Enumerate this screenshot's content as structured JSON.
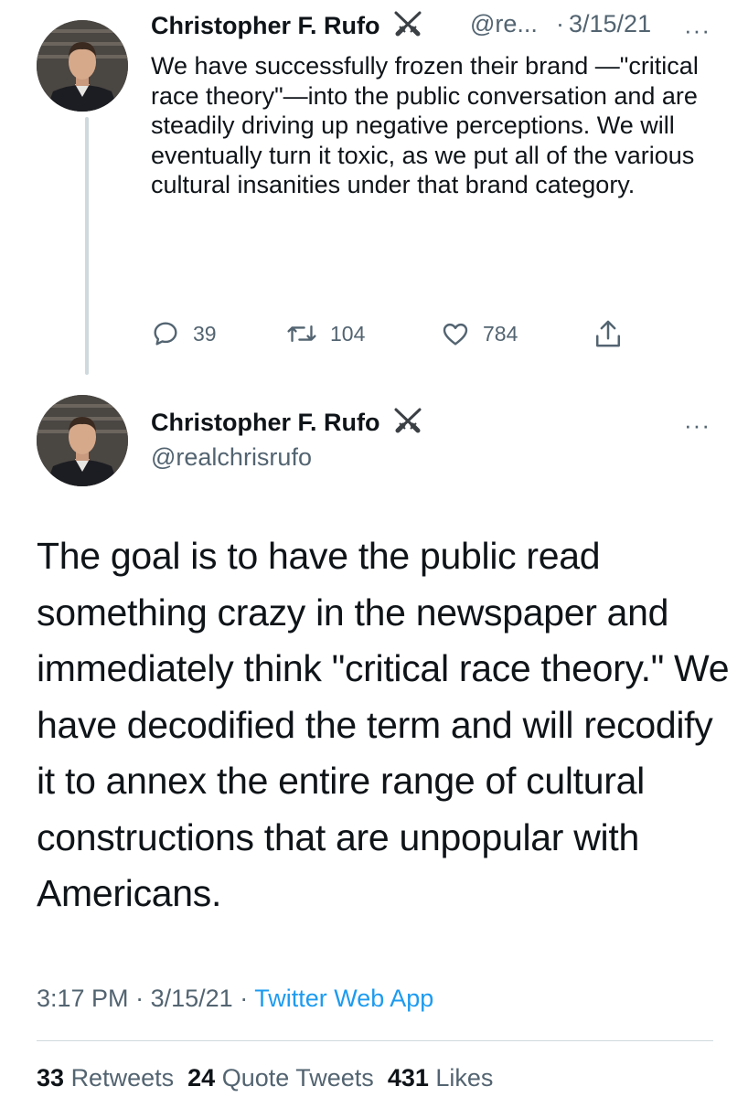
{
  "first_tweet": {
    "author_name": "Christopher F. Rufo",
    "author_handle_truncated": "@re...",
    "separator": "·",
    "date": "3/15/21",
    "more": "···",
    "text": "We have successfully frozen their brand —\"critical race theory\"—into the public conversation and are steadily driving up negative perceptions. We will eventually turn it toxic, as we put all of the various cultural insanities under that brand category.",
    "replies": "39",
    "retweets": "104",
    "likes": "784",
    "icons": {
      "badge": "crossed-swords-icon",
      "reply": "reply-icon",
      "retweet": "retweet-icon",
      "like": "heart-icon",
      "share": "share-icon"
    }
  },
  "main_tweet": {
    "author_name": "Christopher F. Rufo",
    "author_handle": "@realchrisrufo",
    "more": "···",
    "text": "The goal is to have the public read something crazy in the newspaper and immediately think \"critical race theory.\" We have decodified the term and will recodify it to annex the entire range of cultural constructions that are unpopular with Americans.",
    "time": "3:17 PM",
    "separator": "·",
    "date": "3/15/21",
    "app": "Twitter Web App",
    "retweets_count": "33",
    "retweets_label": "Retweets",
    "quotes_count": "24",
    "quotes_label": "Quote Tweets",
    "likes_count": "431",
    "likes_label": "Likes"
  },
  "colors": {
    "text": "#0f1419",
    "muted": "#536471",
    "link": "#1d9bf0",
    "divider": "#cfd9de"
  }
}
